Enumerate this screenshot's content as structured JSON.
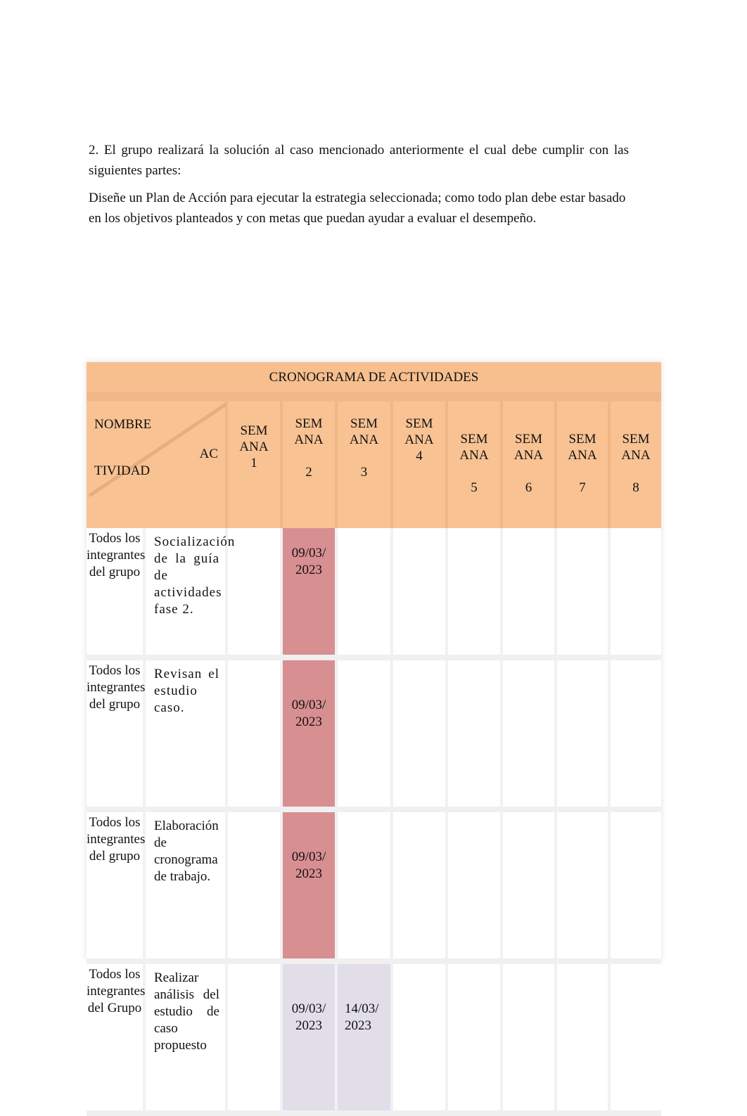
{
  "document": {
    "paragraph_1": "2. El grupo realizará la solución al caso mencionado anteriormente el cual debe cumplir con las siguientes partes:",
    "paragraph_2": "Diseñe un Plan de Acción para ejecutar la estrategia seleccionada; como todo plan debe estar basado en los objetivos planteados y con metas que puedan ayudar a evaluar el desempeño."
  },
  "schedule": {
    "title": "CRONOGRAMA DE ACTIVIDADES",
    "corner": {
      "top": "NOMBRE",
      "right": "AC",
      "bottom": "TIVIDAD"
    },
    "weeks": [
      {
        "label": "SEM ANA",
        "num": "1"
      },
      {
        "label": "SEM ANA",
        "num": "2"
      },
      {
        "label": "SEM ANA",
        "num": "3"
      },
      {
        "label": "SEM ANA",
        "num": "4"
      },
      {
        "label": "SEM ANA",
        "num": "5"
      },
      {
        "label": "SEM ANA",
        "num": "6"
      },
      {
        "label": "SEM ANA",
        "num": "7"
      },
      {
        "label": "SEM ANA",
        "num": "8"
      }
    ],
    "rows": [
      {
        "who": "Todos los integrantes del grupo",
        "activity": "Socialización de la guía de actividades fase 2.",
        "week2": "09/03/ 2023",
        "week3": ""
      },
      {
        "who": "Todos los integrantes del grupo",
        "activity": "Revisan el estudio caso.",
        "week2": "09/03/ 2023",
        "week3": ""
      },
      {
        "who": "Todos los integrantes del grupo",
        "activity": "Elaboración de cronograma de trabajo.",
        "week2": "09/03/ 2023",
        "week3": ""
      },
      {
        "who": "Todos los integrantes del Grupo",
        "activity": "Realizar análisis del estudio de caso propuesto",
        "week2": "09/03/ 2023",
        "week3": "14/03/ 2023"
      }
    ],
    "colors": {
      "header": "#f9c293",
      "highlight_red": "#d88f91",
      "highlight_lavender": "#e1dee9"
    }
  }
}
